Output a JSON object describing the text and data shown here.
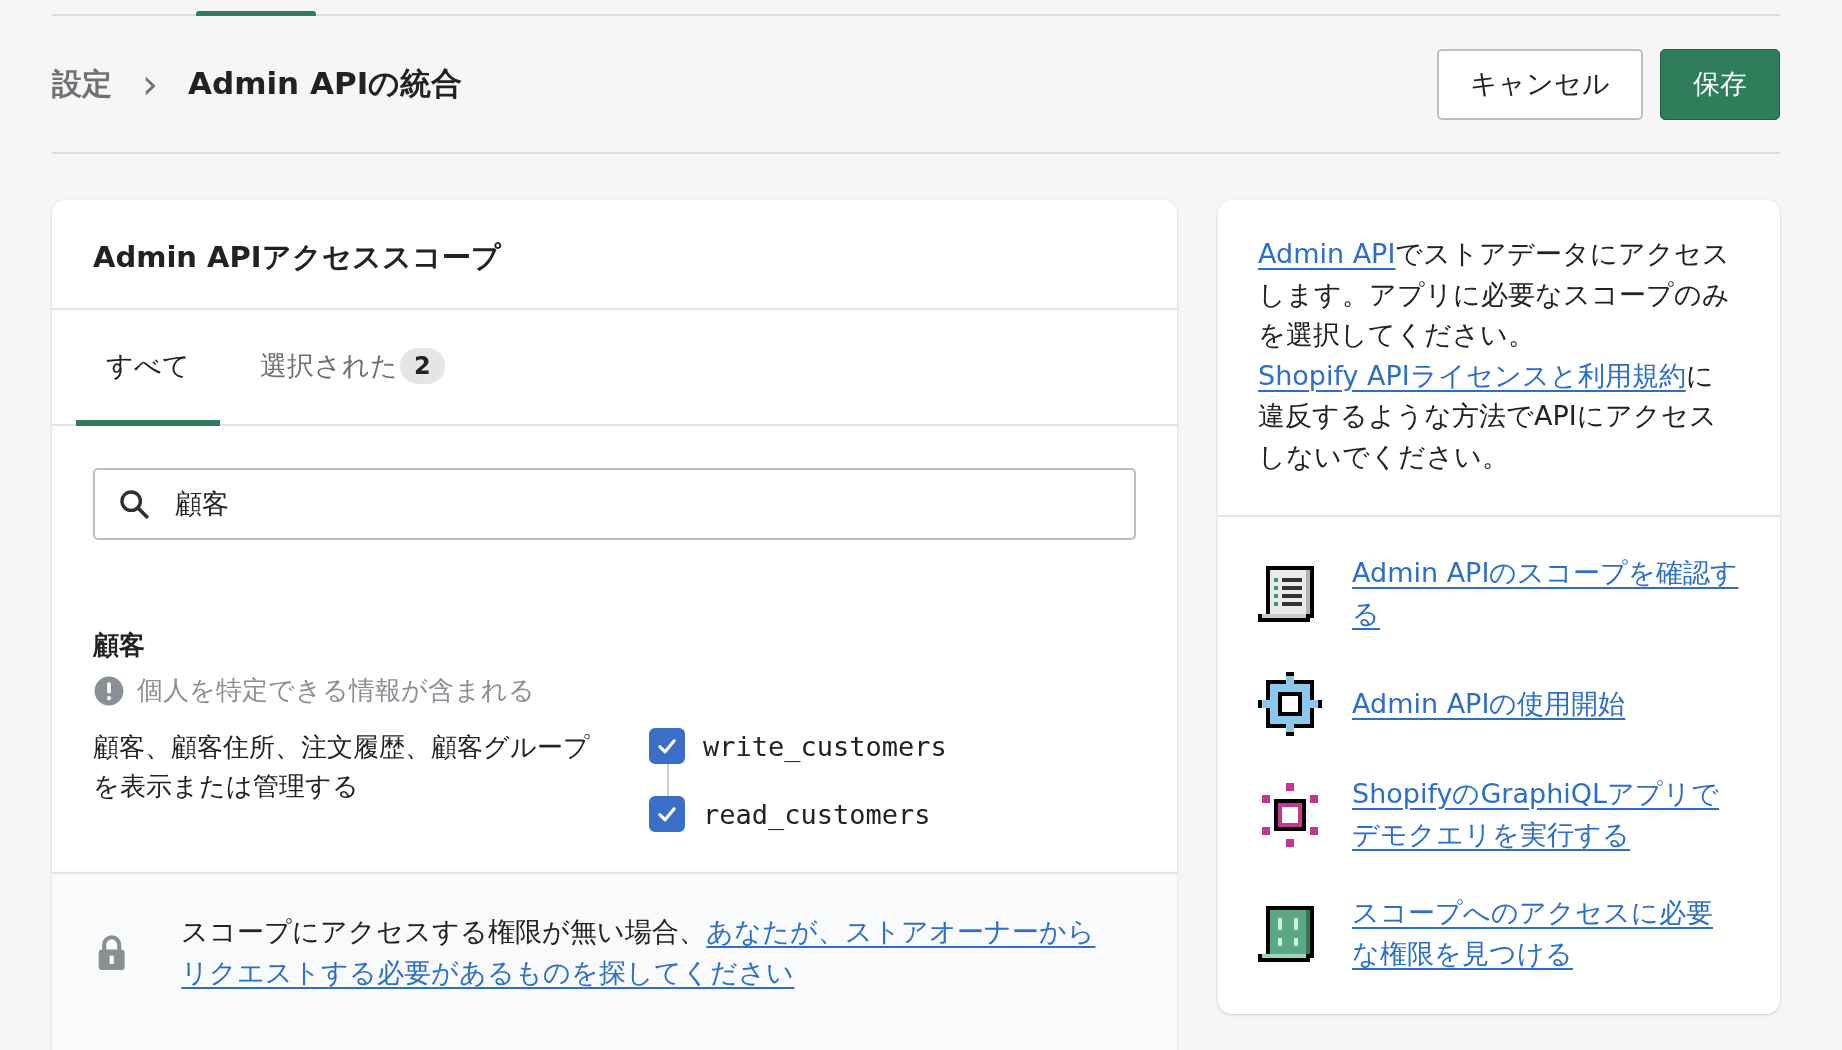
{
  "breadcrumb": {
    "parent": "設定",
    "separator": "›",
    "current": "Admin APIの統合"
  },
  "actions": [
    {
      "label": "キャンセル",
      "kind": "secondary"
    },
    {
      "label": "保存",
      "kind": "primary"
    }
  ],
  "scope_card": {
    "title": "Admin APIアクセススコープ",
    "tabs": [
      {
        "label": "すべて",
        "selected": true
      },
      {
        "label": "選択された",
        "count": "2",
        "selected": false
      }
    ],
    "search": {
      "value": "顧客"
    },
    "group": {
      "title": "顧客",
      "warning": "個人を特定できる情報が含まれる",
      "description": "顧客、顧客住所、注文履歴、顧客グループを表示または管理する",
      "scopes": [
        {
          "name": "write_customers",
          "checked": true
        },
        {
          "name": "read_customers",
          "checked": true
        }
      ]
    }
  },
  "notice": {
    "segments": [
      {
        "text": "スコープにアクセスする権限が無い場合、",
        "kind": "text"
      },
      {
        "text": "あなたが、ストアオーナーから",
        "kind": "link"
      },
      {
        "text": "リクエストする必要があるものを探してください",
        "kind": "link"
      }
    ]
  },
  "sidebar": {
    "intro": [
      {
        "text": "Admin API",
        "kind": "link"
      },
      {
        "text": "でストアデータにアクセスします。アプリに必要なスコープのみを選択してください。",
        "kind": "text"
      },
      {
        "text": "Shopify APIライセンスと利用規約",
        "kind": "link"
      },
      {
        "text": "に違反するような方法でAPIにアクセスしないでください。",
        "kind": "text"
      }
    ],
    "links": [
      {
        "text": "Admin APIのスコープを確認する"
      },
      {
        "text": "Admin APIの使用開始"
      },
      {
        "text": "ShopifyのGraphiQLアプリでデモクエリを実行する"
      },
      {
        "text": "スコープへのアクセスに必要な権限を見つける"
      }
    ]
  }
}
